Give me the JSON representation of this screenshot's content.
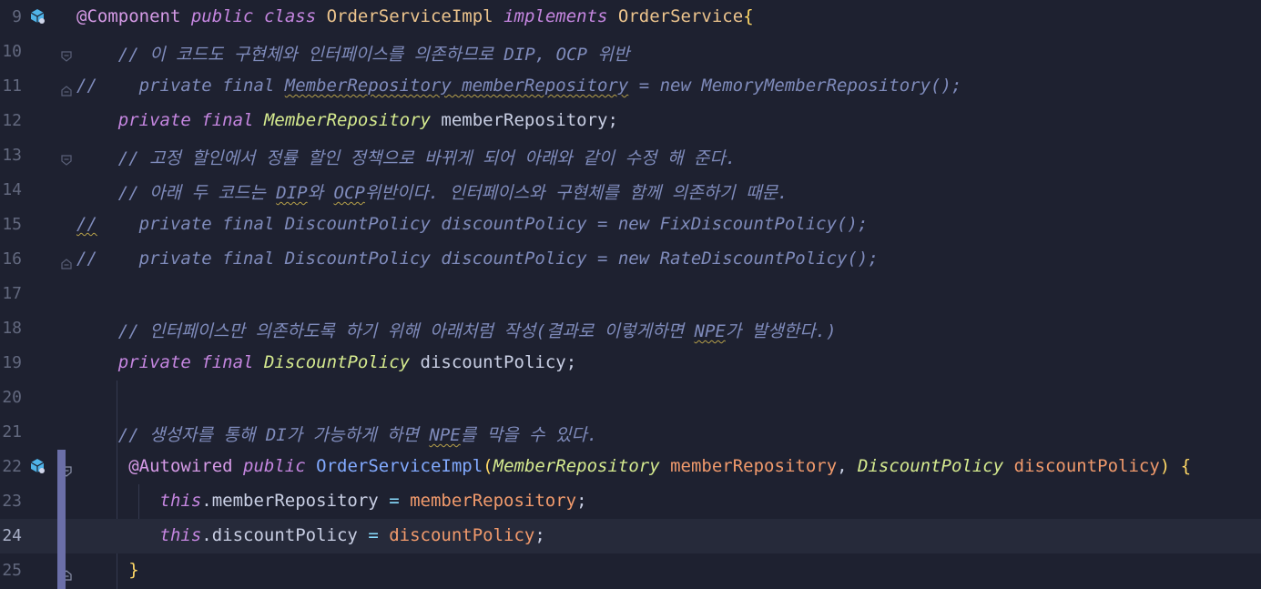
{
  "editor": {
    "current_line": "24",
    "lines": [
      {
        "num": "9",
        "t": [
          "@Component",
          " ",
          "public",
          " ",
          "class",
          " ",
          "OrderServiceImpl",
          " ",
          "implements",
          " ",
          "OrderService",
          "{"
        ]
      },
      {
        "num": "10",
        "t": [
          "    // 이 코드도 구현체와 인터페이스를 의존하므로 DIP, OCP 위반"
        ]
      },
      {
        "num": "11",
        "t": [
          "//    private final ",
          "MemberRepository memberRepository",
          " = new MemoryMemberRepository();"
        ]
      },
      {
        "num": "12",
        "t": [
          "    ",
          "private",
          " ",
          "final",
          " ",
          "MemberRepository",
          " memberRepository;"
        ]
      },
      {
        "num": "13",
        "t": [
          "    // 고정 할인에서 정률 할인 정책으로 바뀌게 되어 아래와 같이 수정 해 준다."
        ]
      },
      {
        "num": "14",
        "t": [
          "    // 아래 두 코드는 ",
          "DIP",
          "와 ",
          "OCP",
          "위반이다. 인터페이스와 구현체를 함께 의존하기 때문."
        ]
      },
      {
        "num": "15",
        "t": [
          "//",
          "    private final DiscountPolicy discountPolicy = new FixDiscountPolicy();"
        ]
      },
      {
        "num": "16",
        "t": [
          "//    private final DiscountPolicy discountPolicy = new RateDiscountPolicy();"
        ]
      },
      {
        "num": "17",
        "t": [
          ""
        ]
      },
      {
        "num": "18",
        "t": [
          "    // 인터페이스만 의존하도록 하기 위해 아래처럼 작성(결과로 이렇게하면 ",
          "NPE",
          "가 발생한다.)"
        ]
      },
      {
        "num": "19",
        "t": [
          "    ",
          "private",
          " ",
          "final",
          " ",
          "DiscountPolicy",
          " discountPolicy;"
        ]
      },
      {
        "num": "20",
        "t": [
          ""
        ]
      },
      {
        "num": "21",
        "t": [
          "    // 생성자를 통해 DI가 가능하게 하면 ",
          "NPE",
          "를 막을 수 있다."
        ]
      },
      {
        "num": "22",
        "t": [
          "     ",
          "@Autowired",
          " ",
          "public",
          " ",
          "OrderServiceImpl",
          "(",
          "MemberRepository",
          " ",
          "memberRepository",
          ", ",
          "DiscountPolicy",
          " ",
          "discountPolicy",
          ") ",
          "{"
        ]
      },
      {
        "num": "23",
        "t": [
          "        ",
          "this",
          ".memberRepository ",
          "=",
          " ",
          "memberRepository",
          ";"
        ]
      },
      {
        "num": "24",
        "t": [
          "        ",
          "this",
          ".discountPolicy ",
          "=",
          " ",
          "discountPolicy",
          ";"
        ]
      },
      {
        "num": "25",
        "t": [
          "     ",
          "}"
        ]
      }
    ]
  },
  "icons": {
    "gutter_bean_line9": "spring-bean-icon",
    "gutter_bean_line22": "spring-autowire-icon",
    "fold": "fold-icon"
  },
  "colors": {
    "background": "#1e2130",
    "current_line": "#262a3a",
    "keyword": "#c586e0",
    "type": "#ecc48d",
    "comment": "#7f8bbb",
    "parameter": "#f19a6c",
    "function": "#82aaff",
    "change_bar": "#6b6fa8"
  }
}
